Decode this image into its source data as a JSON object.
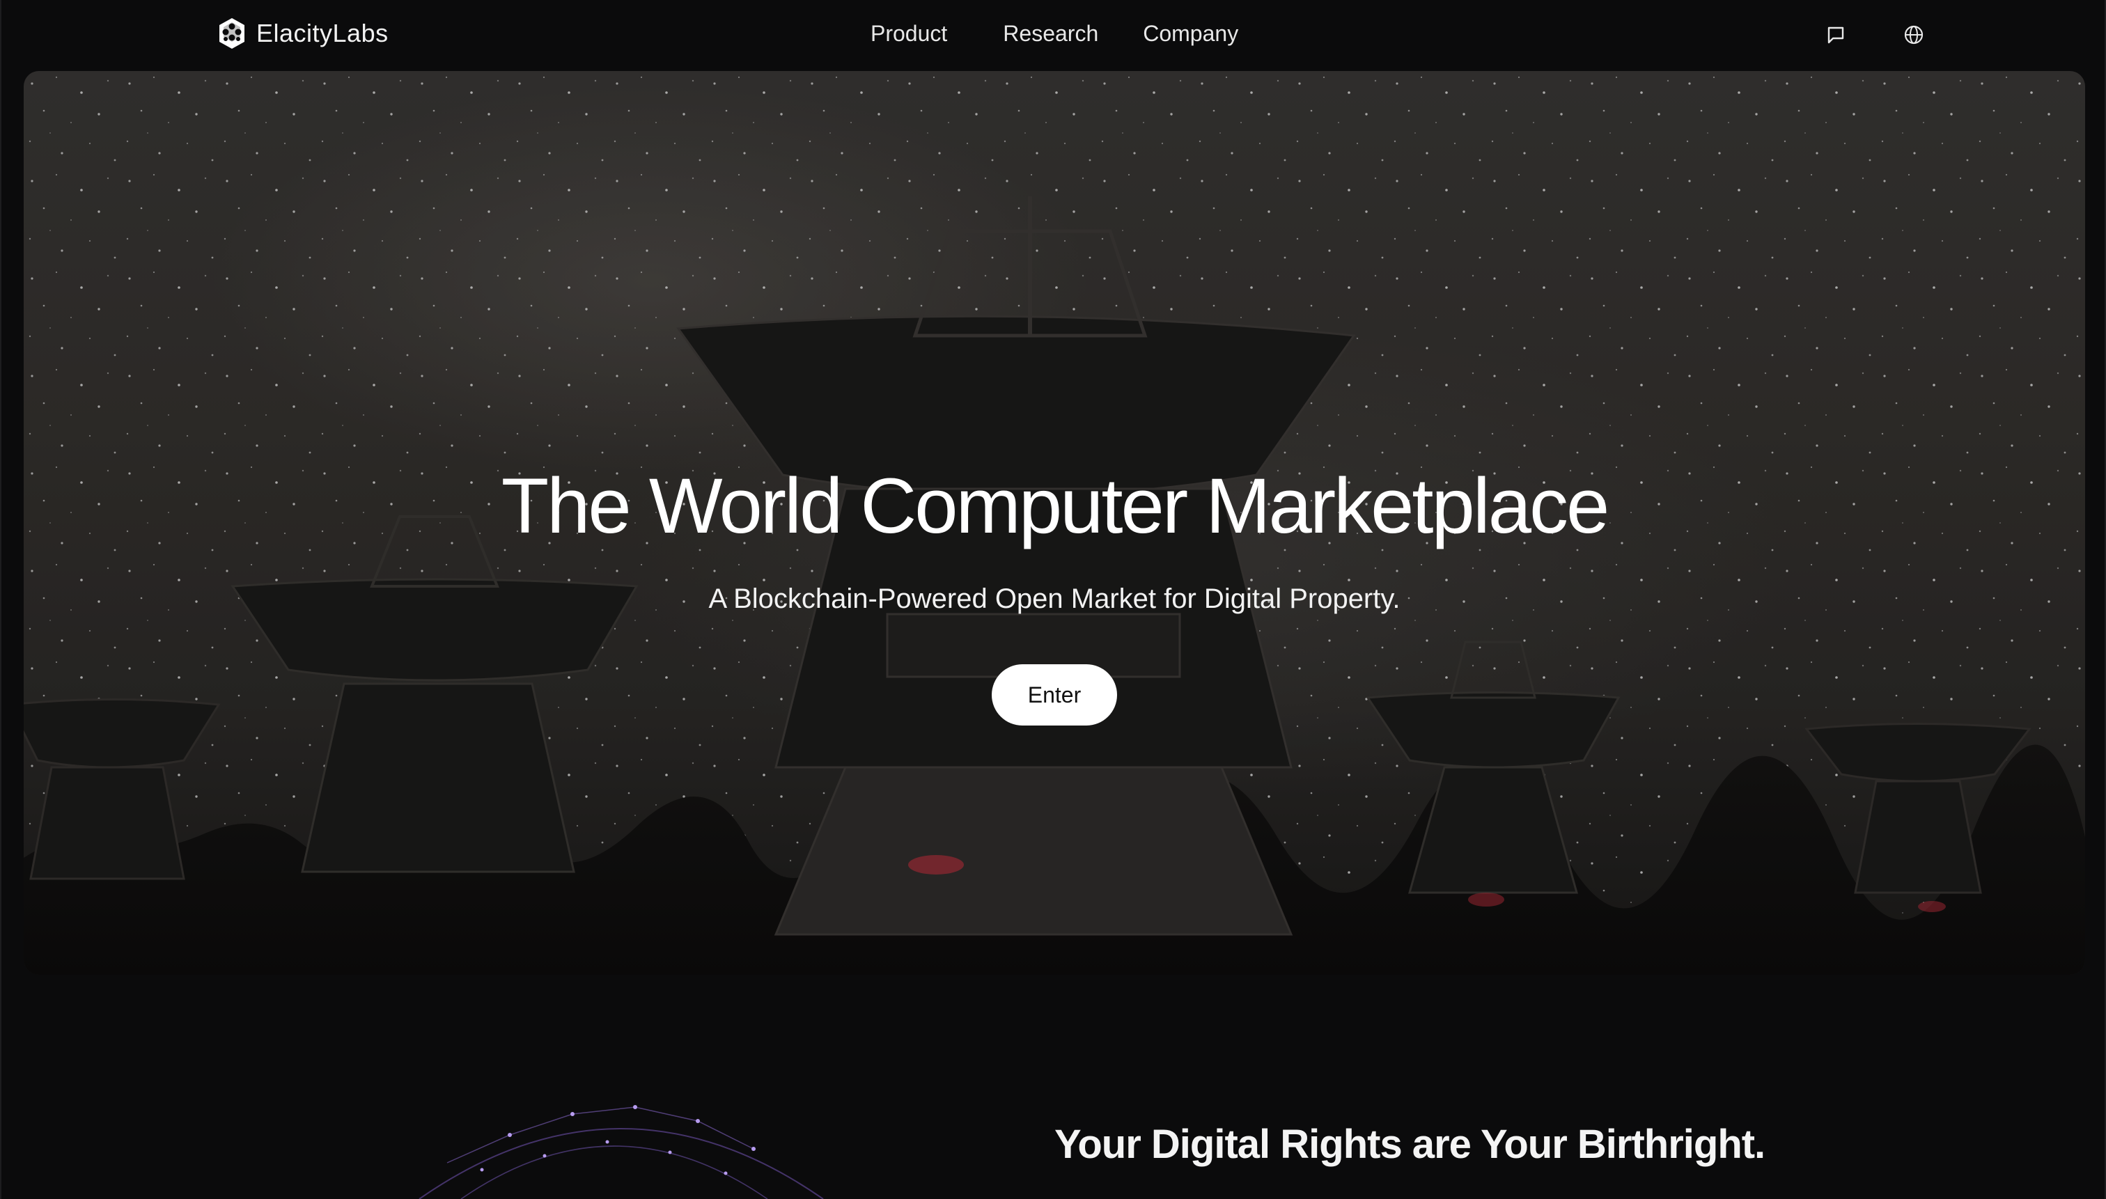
{
  "nav": {
    "brand": "ElacityLabs",
    "links": [
      {
        "label": "Product"
      },
      {
        "label": "Research"
      },
      {
        "label": "Company"
      }
    ],
    "icons": [
      "chat-icon",
      "globe-icon"
    ]
  },
  "hero": {
    "title": "The World Computer Marketplace",
    "subtitle": "A Blockchain-Powered Open Market for Digital Property.",
    "cta": "Enter"
  },
  "section": {
    "title": "Your Digital Rights are Your Birthright."
  },
  "colors": {
    "background": "#0b0b0c",
    "text": "#ffffff",
    "button_bg": "#ffffff",
    "button_text": "#111111"
  }
}
